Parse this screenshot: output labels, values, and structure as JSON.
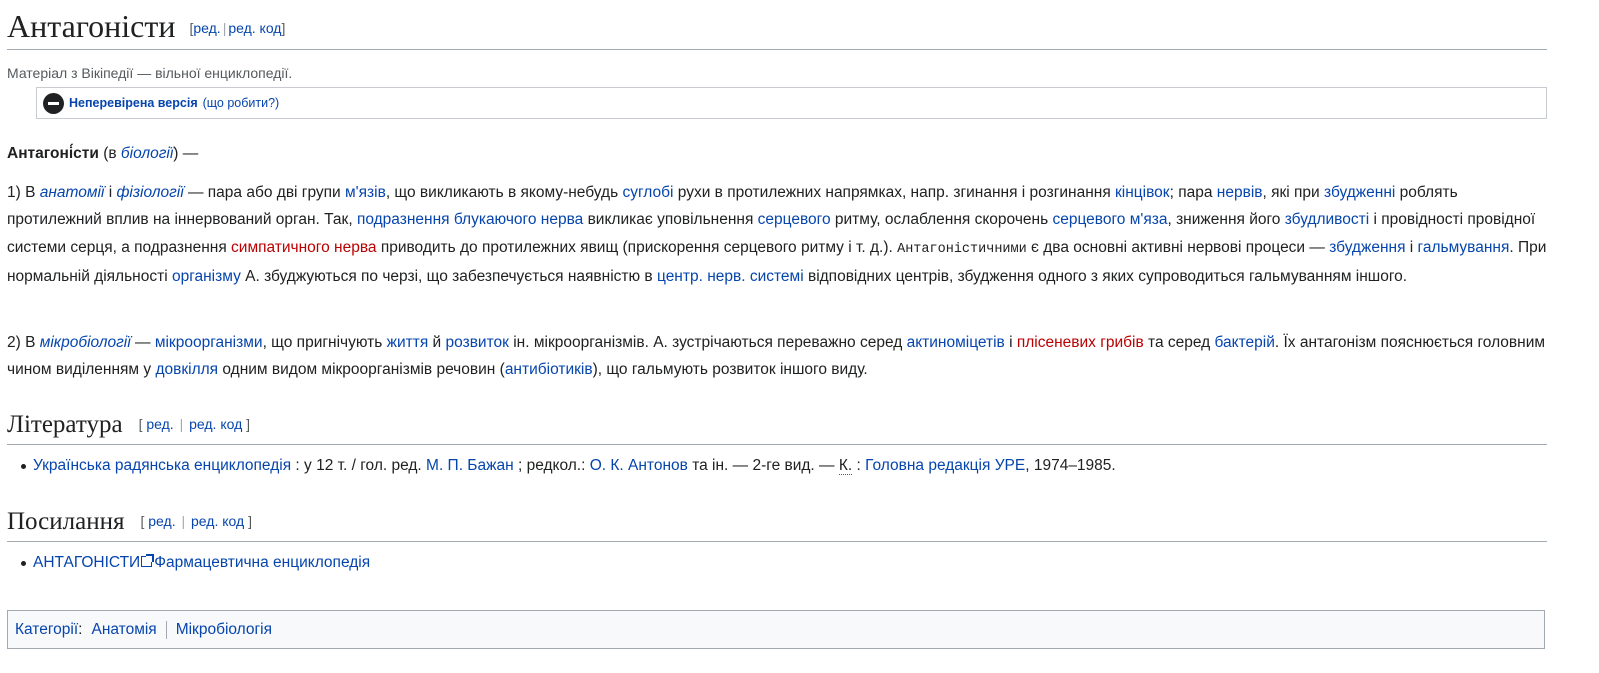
{
  "title": "Антагоністи",
  "edit": {
    "open": "[",
    "close": "]",
    "sep": "|",
    "edit": "ред.",
    "edit_code": "ред. код"
  },
  "site_sub": "Матеріал з Вікіпедії — вільної енциклопедії.",
  "flagged": {
    "label": "Неперевірена версія",
    "help": "(що робити?)"
  },
  "lead": {
    "term": "Антагоні́сти",
    "pre": " (в ",
    "link": "біології",
    "post": ") —"
  },
  "p1": [
    {
      "t": "1) В "
    },
    {
      "t": "анатомії",
      "k": "li"
    },
    {
      "t": " і "
    },
    {
      "t": "фізіології",
      "k": "li"
    },
    {
      "t": " — пара або дві групи "
    },
    {
      "t": "м'язів",
      "k": "l"
    },
    {
      "t": ", що викликають в якому-небудь "
    },
    {
      "t": "суглобі",
      "k": "l"
    },
    {
      "t": " рухи в протилежних напрямках, напр. згинання і розгинання "
    },
    {
      "t": "кінцівок",
      "k": "l"
    },
    {
      "t": "; пара "
    },
    {
      "t": "нервів",
      "k": "l"
    },
    {
      "t": ", які при "
    },
    {
      "t": "збудженні",
      "k": "l"
    },
    {
      "t": " роблять протилежний вплив на іннервований орган. Так, "
    },
    {
      "t": "подразнення",
      "k": "l"
    },
    {
      "t": " "
    },
    {
      "t": "блукаючого нерва",
      "k": "l"
    },
    {
      "t": " викликає уповільнення "
    },
    {
      "t": "серцевого",
      "k": "l"
    },
    {
      "t": " ритму, ослаблення скорочень "
    },
    {
      "t": "серцевого м'яза",
      "k": "l"
    },
    {
      "t": ", зниження його "
    },
    {
      "t": "збудливості",
      "k": "l"
    },
    {
      "t": " і провідності провідної системи серця, а подразнення "
    },
    {
      "t": "симпатичного нерва",
      "k": "r"
    },
    {
      "t": " приводить до протилежних явищ (прискорення серцевого ритму і т. д.). "
    },
    {
      "t": "Антагоністичними",
      "k": "m"
    },
    {
      "t": " є два основні активні нервові процеси — "
    },
    {
      "t": "збудження",
      "k": "l"
    },
    {
      "t": " і "
    },
    {
      "t": "гальмування",
      "k": "l"
    },
    {
      "t": ". При нормальній діяльності "
    },
    {
      "t": "організму",
      "k": "l"
    },
    {
      "t": " А. збуджуються по черзі, що забезпечується наявністю в "
    },
    {
      "t": "центр. нерв. системі",
      "k": "l"
    },
    {
      "t": " відповідних центрів, збудження одного з яких супроводиться гальмуванням іншого."
    }
  ],
  "p2": [
    {
      "t": "2) В "
    },
    {
      "t": "мікробіології",
      "k": "li"
    },
    {
      "t": " — "
    },
    {
      "t": "мікроорганізми",
      "k": "l"
    },
    {
      "t": ", що пригнічують "
    },
    {
      "t": "життя",
      "k": "l"
    },
    {
      "t": " й "
    },
    {
      "t": "розвиток",
      "k": "l"
    },
    {
      "t": " ін. мікроорганізмів. А. зустрічаються переважно серед "
    },
    {
      "t": "актиноміцетів",
      "k": "l"
    },
    {
      "t": " і "
    },
    {
      "t": "плісеневих грибів",
      "k": "r"
    },
    {
      "t": " та серед "
    },
    {
      "t": "бактерій",
      "k": "l"
    },
    {
      "t": ". Їх антагонізм пояснюється головним чином виділенням у "
    },
    {
      "t": "довкілля",
      "k": "l"
    },
    {
      "t": " одним видом мікроорганізмів речовин ("
    },
    {
      "t": "антибіотиків",
      "k": "l"
    },
    {
      "t": "), що гальмують розвиток іншого виду."
    }
  ],
  "lit": {
    "heading": "Література",
    "item": [
      {
        "t": "Українська радянська енциклопедія",
        "k": "l"
      },
      {
        "t": " : у 12 т. / гол. ред. "
      },
      {
        "t": "М. П. Бажан",
        "k": "l"
      },
      {
        "t": " ; редкол.: "
      },
      {
        "t": "О. К. Антонов",
        "k": "l"
      },
      {
        "t": " та ін. — 2-ге вид. — "
      },
      {
        "t": "К.",
        "k": "a"
      },
      {
        "t": " : "
      },
      {
        "t": "Головна редакція УРЕ",
        "k": "l"
      },
      {
        "t": ", 1974–1985."
      }
    ]
  },
  "links": {
    "heading": "Посилання",
    "item_link": "АНТАГОНІСТИ",
    "item_icon": "external-link-icon",
    "item_rest": "Фармацевтична енциклопедія"
  },
  "categories": {
    "label": "Категорії",
    "colon": ":",
    "items": [
      "Анатомія",
      "Мікробіологія"
    ]
  },
  "colors": {
    "link": "#0645ad",
    "redlink": "#ba0000",
    "text": "#202122",
    "border": "#a2a9b1"
  }
}
